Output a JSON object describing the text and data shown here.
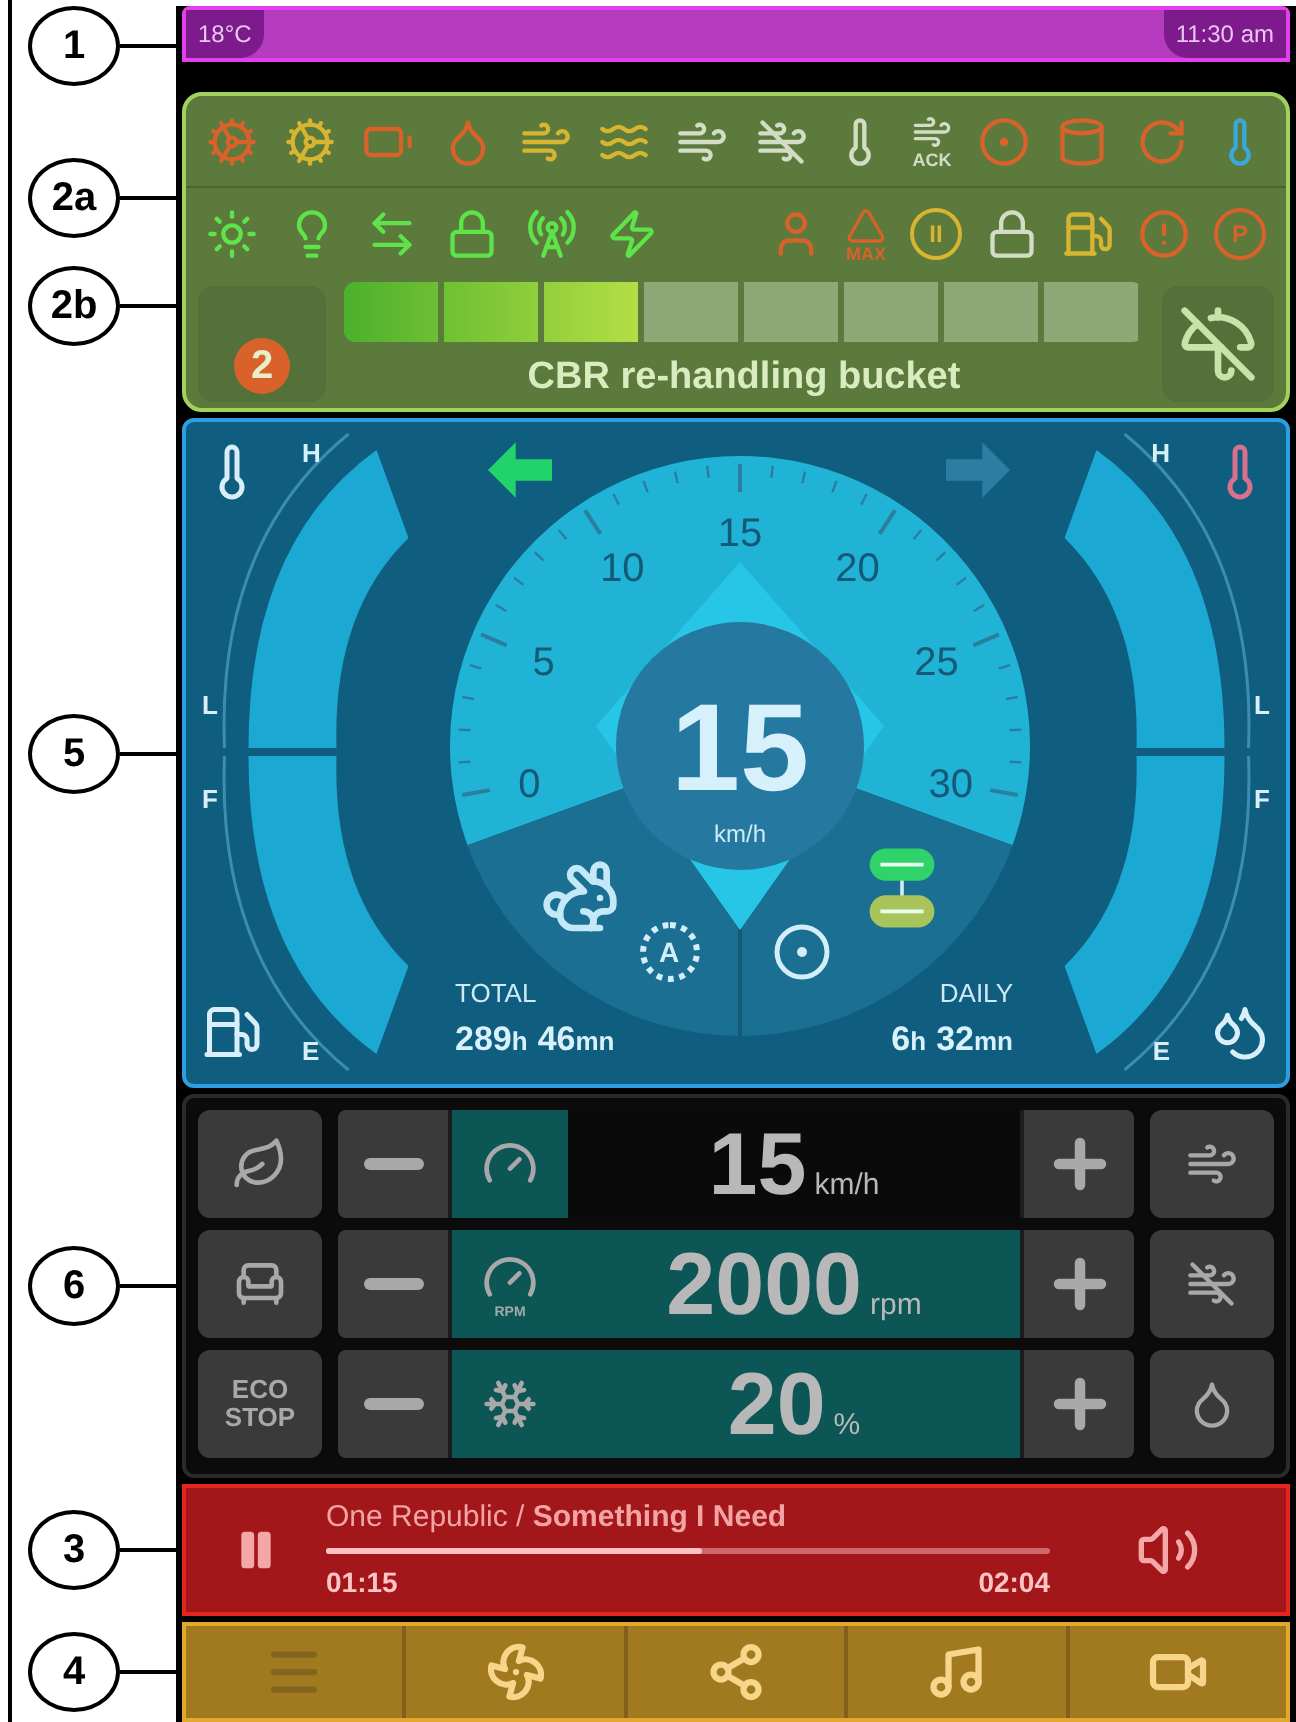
{
  "status_bar": {
    "callout": "1",
    "temperature": "18°C",
    "time": "11:30 am"
  },
  "warning_panel": {
    "callouts": [
      "2a",
      "2b"
    ],
    "top_row": [
      {
        "kind": "engine",
        "color": "#d9622b"
      },
      {
        "kind": "engine",
        "color": "#d8b531"
      },
      {
        "kind": "battery",
        "color": "#d9622b"
      },
      {
        "kind": "oil",
        "color": "#d9622b"
      },
      {
        "kind": "dpf",
        "color": "#d8b531"
      },
      {
        "kind": "water",
        "color": "#d8b531"
      },
      {
        "kind": "dpf",
        "color": "#d3ddc6"
      },
      {
        "kind": "dpf_off",
        "color": "#d3ddc6"
      },
      {
        "kind": "dpf_temp",
        "color": "#d3ddc6"
      },
      {
        "kind": "dpf",
        "color": "#d3ddc6",
        "label": "ACK"
      },
      {
        "kind": "brake",
        "color": "#d9622b"
      },
      {
        "kind": "hydraulic",
        "color": "#d9622b"
      },
      {
        "kind": "transmission",
        "color": "#d9622b"
      },
      {
        "kind": "coolant",
        "color": "#3aa8d8"
      }
    ],
    "bottom_row_left": [
      {
        "kind": "sidelights",
        "color": "#5fe34a"
      },
      {
        "kind": "headlight",
        "color": "#5fe34a"
      },
      {
        "kind": "arrows",
        "color": "#5fe34a"
      },
      {
        "kind": "lockpin",
        "color": "#5fe34a"
      },
      {
        "kind": "antenna",
        "color": "#5fe34a"
      },
      {
        "kind": "lightning",
        "color": "#5fe34a"
      }
    ],
    "bottom_row_right": [
      {
        "kind": "seatbelt",
        "color": "#d9622b"
      },
      {
        "kind": "max",
        "color": "#d9622b",
        "label": "MAX"
      },
      {
        "kind": "ring",
        "color": "#d8b531",
        "label": "II"
      },
      {
        "kind": "axle_lock",
        "color": "#d3ddc6"
      },
      {
        "kind": "fuel",
        "color": "#d8b531"
      },
      {
        "kind": "alert",
        "color": "#d9622b"
      },
      {
        "kind": "ring",
        "color": "#d9622b",
        "label": "P"
      }
    ],
    "attachment": {
      "gear": "2",
      "level": 0.375,
      "name": "CBR re-handling bucket"
    }
  },
  "instrument_panel": {
    "callout": "5",
    "left_gauges": [
      {
        "kind": "oil_temp",
        "top_label": "H",
        "bottom_label": "L"
      },
      {
        "kind": "fuel",
        "top_label": "F",
        "bottom_label": "E"
      }
    ],
    "right_gauges": [
      {
        "kind": "coolant_temp",
        "top_label": "H",
        "bottom_label": "L"
      },
      {
        "kind": "def",
        "top_label": "F",
        "bottom_label": "E"
      }
    ],
    "turn_left": {
      "on": true
    },
    "turn_right": {
      "on": false
    },
    "speedometer": {
      "scale": [
        "0",
        "5",
        "10",
        "15",
        "20",
        "25",
        "30"
      ],
      "speed": "15",
      "unit": "km/h"
    },
    "auto_mode": "A",
    "total": {
      "label": "TOTAL",
      "hours": "289",
      "hours_unit": "h",
      "minutes": "46",
      "minutes_unit": "mn"
    },
    "daily": {
      "label": "DAILY",
      "hours": "6",
      "hours_unit": "h",
      "minutes": "32",
      "minutes_unit": "mn"
    }
  },
  "control_panel": {
    "callout": "6",
    "left_buttons": [
      {
        "kind": "leaf"
      },
      {
        "kind": "seat"
      },
      {
        "kind": "eco_stop",
        "label": "ECO STOP"
      }
    ],
    "setpoints": [
      {
        "kind": "speed",
        "value": "15",
        "unit": "km/h",
        "highlighted": false
      },
      {
        "kind": "rpm",
        "value": "2000",
        "unit": "rpm",
        "highlighted": true,
        "icon_label": "RPM"
      },
      {
        "kind": "fan",
        "value": "20",
        "unit": "%",
        "highlighted": true
      }
    ],
    "right_buttons": [
      {
        "kind": "dpf"
      },
      {
        "kind": "dpf_off"
      },
      {
        "kind": "tank_off"
      }
    ]
  },
  "media_player": {
    "callout": "3",
    "playing": true,
    "track": "One Republic / **Something I Need**",
    "level": 0.52,
    "elapsed": "01:15",
    "duration": "02:04"
  },
  "nav_bar": {
    "callout": "4",
    "tabs": [
      {
        "kind": "menu",
        "disabled": true
      },
      {
        "kind": "fan",
        "disabled": false
      },
      {
        "kind": "network",
        "disabled": false
      },
      {
        "kind": "music",
        "disabled": false
      },
      {
        "kind": "video",
        "disabled": false
      }
    ]
  }
}
